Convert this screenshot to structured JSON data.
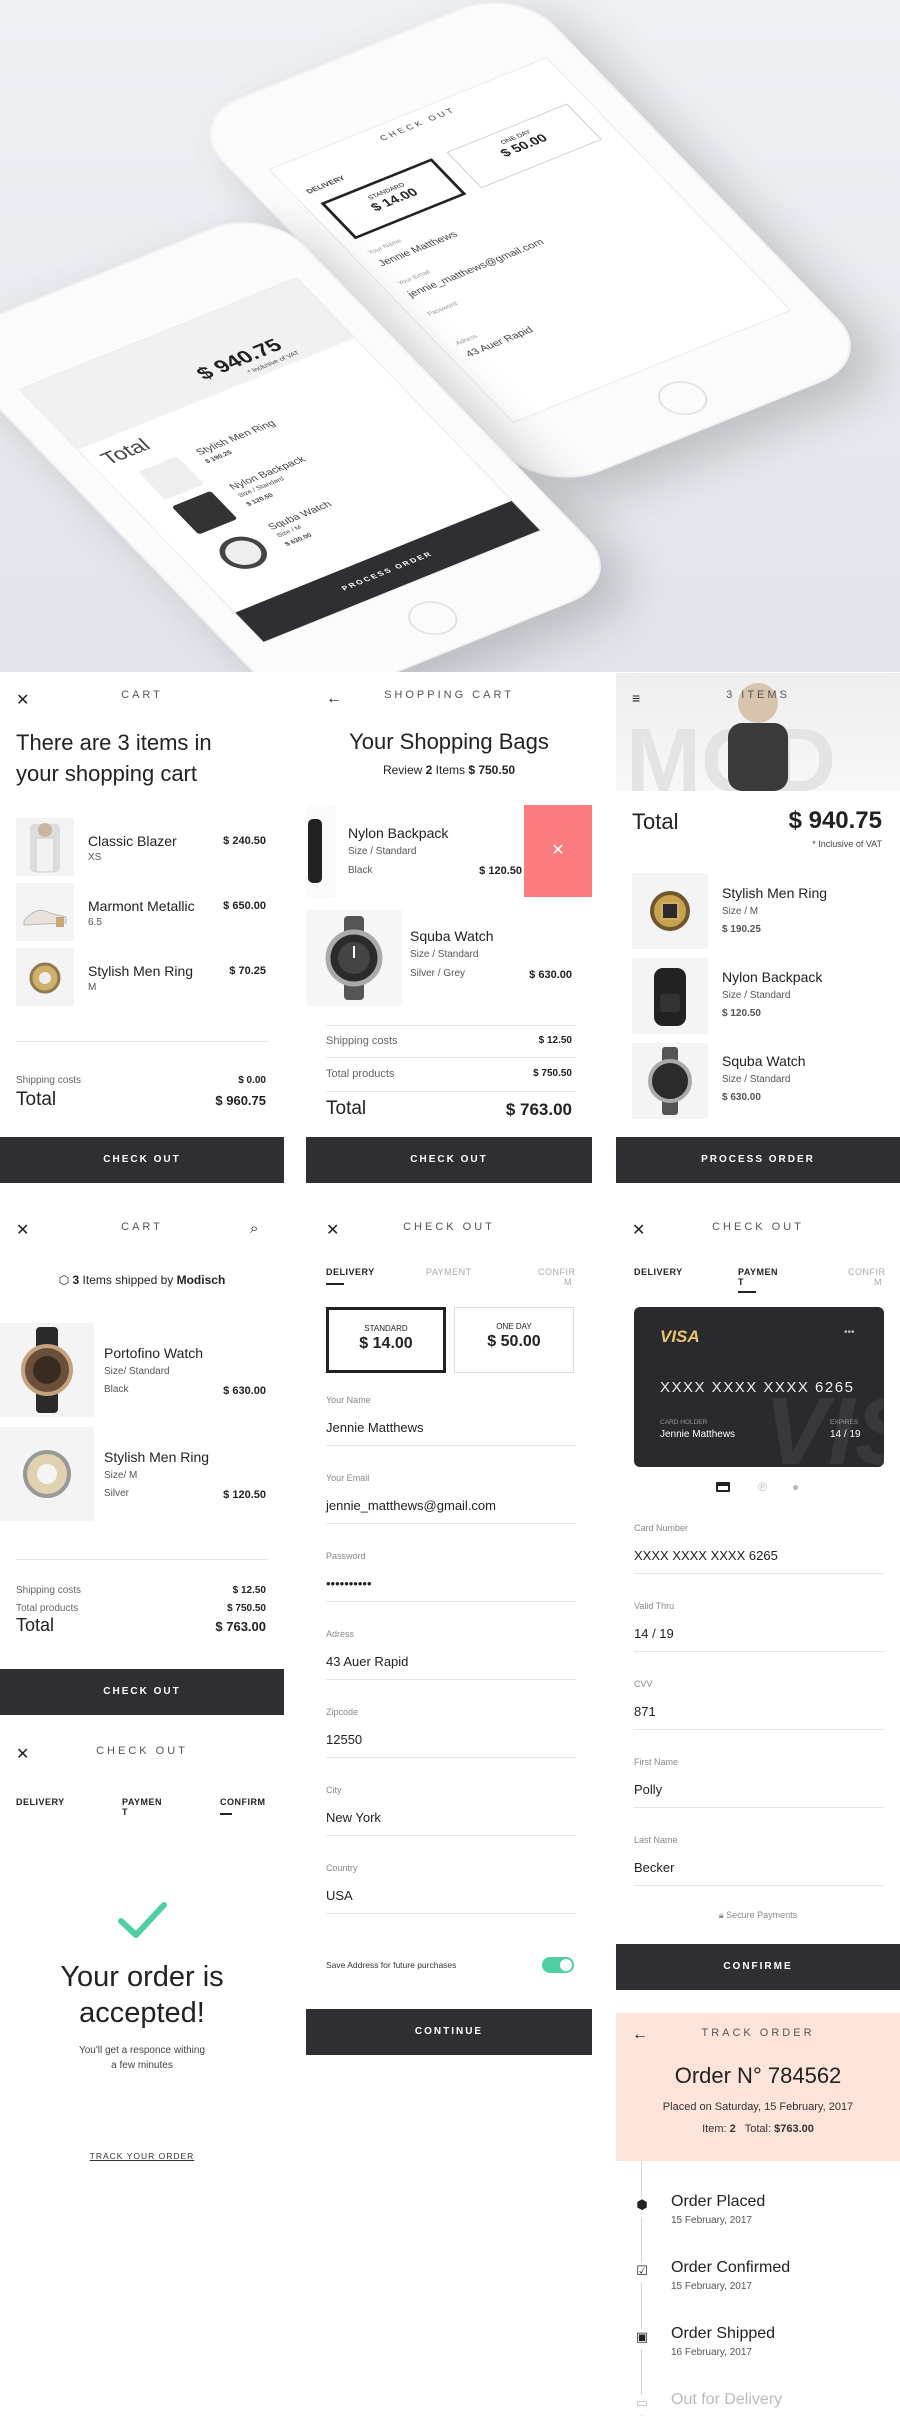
{
  "hero": {
    "back": {
      "title": "CHECK OUT",
      "tab": "DELIVERY",
      "opt1_label": "STANDARD",
      "opt1_price": "$ 14.00",
      "opt2_label": "ONE DAY",
      "opt2_price": "$ 50.00",
      "name_label": "Your Name",
      "name": "Jennie Matthews",
      "email_label": "Your Email",
      "email": "jennie_matthews@gmail.com",
      "pw_label": "Password",
      "addr_label": "Adress",
      "addr": "43 Auer Rapid"
    },
    "front": {
      "total_label": "Total",
      "total": "$ 940.75",
      "vat": "* Inclusive of VAT",
      "i1": "Stylish Men Ring",
      "i1p": "$ 190.25",
      "i2": "Nylon Backpack",
      "i2s": "Size / Standard",
      "i2p": "$ 120.50",
      "i3": "Squba Watch",
      "i3s": "Size / M",
      "i3p": "$ 630.00",
      "button": "PROCESS ORDER"
    }
  },
  "p1": {
    "title": "CART",
    "headline_a": "There are ",
    "count": "3",
    "headline_b": " items in",
    "headline_c": "your shopping cart",
    "items": [
      {
        "name": "Classic Blazer",
        "sub": "XS",
        "price": "$ 240.50"
      },
      {
        "name": "Marmont Metallic",
        "sub": "6.5",
        "price": "$ 650.00"
      },
      {
        "name": "Stylish Men Ring",
        "sub": "M",
        "price": "$ 70.25"
      }
    ],
    "ship_label": "Shipping costs",
    "ship": "$ 0.00",
    "total_label": "Total",
    "total": "$ 960.75",
    "button": "CHECK OUT"
  },
  "p2": {
    "title": "SHOPPING CART",
    "headline": "Your Shopping Bags",
    "review_a": "Review ",
    "review_n": "2",
    "review_b": " Items ",
    "review_total": "$ 750.50",
    "item1": {
      "name": "Nylon Backpack",
      "size": "Size / Standard",
      "color": "Black",
      "price": "$ 120.50"
    },
    "item2": {
      "name": "Squba Watch",
      "size": "Size / Standard",
      "color": "Silver / Grey",
      "price": "$ 630.00"
    },
    "ship_label": "Shipping costs",
    "ship": "$ 12.50",
    "tp_label": "Total products",
    "tp": "$ 750.50",
    "total_label": "Total",
    "total": "$ 763.00",
    "button": "CHECK OUT"
  },
  "p3": {
    "title": "3 ITEMS",
    "total_label": "Total",
    "total": "$ 940.75",
    "vat": "* Inclusive of VAT",
    "items": [
      {
        "name": "Stylish Men Ring",
        "size": "Size / M",
        "price": "$ 190.25"
      },
      {
        "name": "Nylon Backpack",
        "size": "Size / Standard",
        "price": "$ 120.50"
      },
      {
        "name": "Squba Watch",
        "size": "Size / Standard",
        "price": "$ 630.00"
      }
    ],
    "button": "PROCESS ORDER"
  },
  "p4": {
    "title": "CART",
    "ship_a": "3",
    "ship_b": " Items shipped by ",
    "ship_c": "Modisch",
    "item1": {
      "name": "Portofino Watch",
      "size": "Size/ Standard",
      "color": "Black",
      "price": "$ 630.00"
    },
    "item2": {
      "name": "Stylish Men Ring",
      "size": "Size/ M",
      "color": "Silver",
      "price": "$ 120.50"
    },
    "ship_label": "Shipping costs",
    "ship": "$ 12.50",
    "tp_label": "Total products",
    "tp": "$ 750.50",
    "total_label": "Total",
    "total": "$ 763.00",
    "button": "CHECK OUT"
  },
  "p5": {
    "title": "CHECK OUT",
    "tab1": "DELIVERY",
    "tab2": "PAYMENT",
    "tab3": "CONFIR",
    "tab3b": "M",
    "opt1_label": "STANDARD",
    "opt1_price": "$ 14.00",
    "opt2_label": "ONE DAY",
    "opt2_price": "$ 50.00",
    "fields": [
      {
        "label": "Your Name",
        "value": "Jennie Matthews"
      },
      {
        "label": "Your Email",
        "value": "jennie_matthews@gmail.com"
      },
      {
        "label": "Password",
        "value": "••••••••••"
      },
      {
        "label": "Adress",
        "value": "43 Auer Rapid"
      },
      {
        "label": "Zipcode",
        "value": "12550"
      },
      {
        "label": "City",
        "value": "New York"
      },
      {
        "label": "Country",
        "value": "USA"
      }
    ],
    "save": "Save Address for future purchases",
    "button": "CONTINUE"
  },
  "p6": {
    "title": "CHECK OUT",
    "tab1": "DELIVERY",
    "tab2": "PAYMEN",
    "tab2b": "T",
    "tab3": "CONFIR",
    "tab3b": "M",
    "card": {
      "brand": "VISA",
      "dots": "•••",
      "number": "XXXX  XXXX  XXXX  6265",
      "holder_label": "CARD HOLDER",
      "holder": "Jennie Matthews",
      "exp_label": "EXPIRES",
      "exp": "14 / 19",
      "watermark": "VISA"
    },
    "fields": [
      {
        "label": "Card Number",
        "value": "XXXX XXXX XXXX 6265"
      },
      {
        "label": "Valid Thru",
        "value": "14 / 19"
      },
      {
        "label": "CVV",
        "value": "871"
      },
      {
        "label": "First Name",
        "value": "Polly"
      },
      {
        "label": "Last Name",
        "value": "Becker"
      }
    ],
    "secure": "Secure Payments",
    "button": "CONFIRME"
  },
  "p7": {
    "title": "CHECK OUT",
    "tab1": "DELIVERY",
    "tab2": "PAYMEN",
    "tab2b": "T",
    "tab3": "CONFIRM",
    "headline1": "Your order is",
    "headline2": "accepted!",
    "sub1": "You'll get a responce withing",
    "sub2": "a few minutes",
    "link": "TRACK YOUR ORDER"
  },
  "p8": {
    "title": "TRACK ORDER",
    "order_label": "Order N°",
    "order_no": "784562",
    "placed": "Placed on Saturday, 15 February, 2017",
    "items_label": "Item: ",
    "items": "2",
    "total_label": "Total: ",
    "total": "$763.00",
    "steps": [
      {
        "name": "Order Placed",
        "date": "15 February, 2017"
      },
      {
        "name": "Order Confirmed",
        "date": "15 February, 2017"
      },
      {
        "name": "Order Shipped",
        "date": "16 February, 2017"
      },
      {
        "name": "Out for Delivery",
        "date": ""
      }
    ]
  },
  "colors": {
    "dark": "#2f2f33",
    "delete": "#fa7c80",
    "accent": "#4fcfa3",
    "peach": "#fde4da"
  }
}
